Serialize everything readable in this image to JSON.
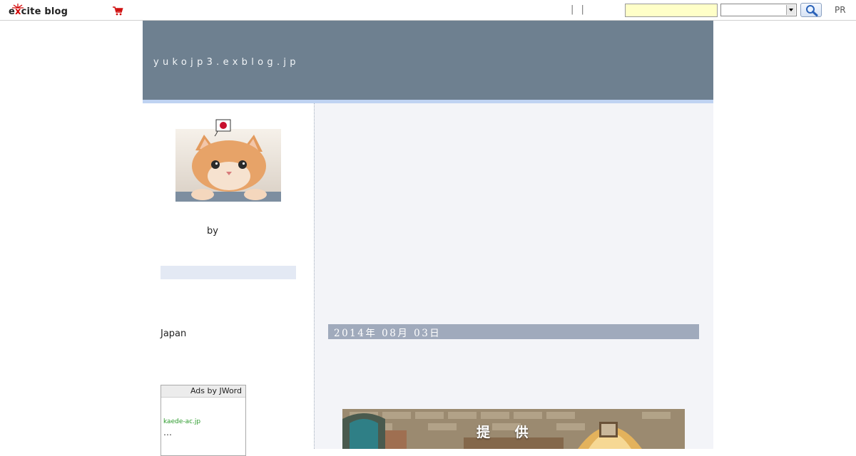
{
  "topbar": {
    "logo_text_prefix": "e",
    "logo_text_x": "x",
    "logo_text_suffix": "cite blog",
    "pipes": "| |",
    "search_placeholder": "",
    "search_select_value": "",
    "pr_label": "PR"
  },
  "header": {
    "blog_title": "yukojp3.exblog.jp"
  },
  "sidebar": {
    "byline": "by",
    "location": "Japan",
    "ad": {
      "header": "Ads by JWord",
      "link_text": "kaede-ac.jp",
      "ellipsis": "…"
    }
  },
  "main": {
    "date": "2014年 08月 03日",
    "image_caption": "提 供"
  },
  "colors": {
    "header_bg": "#6e8090",
    "header_accent": "#bfd3f2",
    "date_bar": "#a0aabc",
    "main_bg": "#f3f4f8",
    "search_field": "#ffffc8"
  },
  "icons": [
    "excite-logo-icon",
    "cart-icon",
    "search-icon",
    "chevron-down-icon",
    "flag-icon"
  ]
}
